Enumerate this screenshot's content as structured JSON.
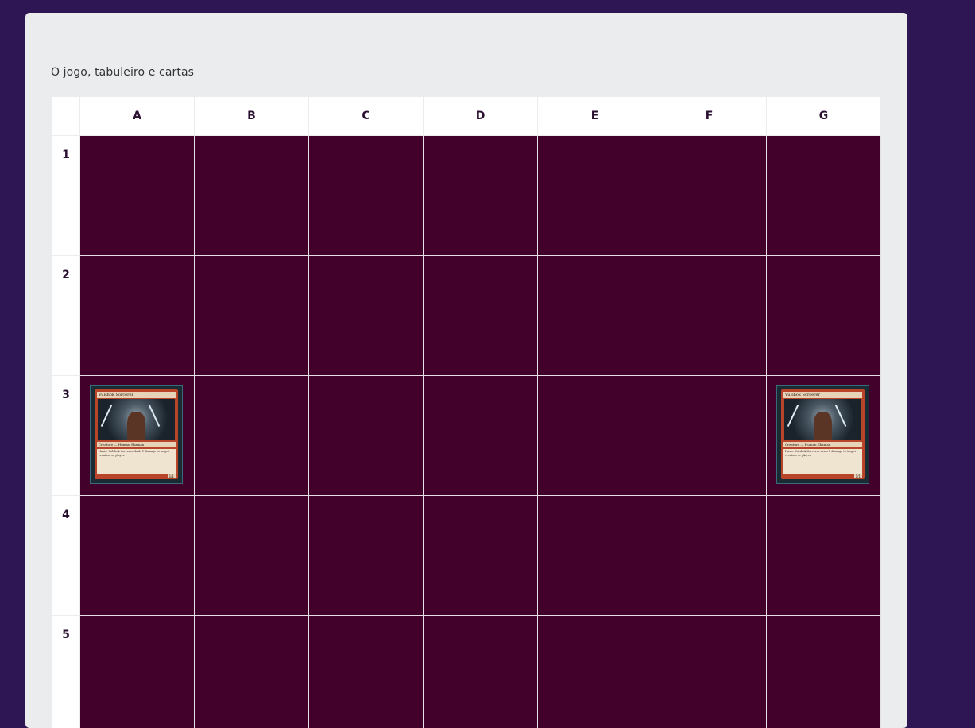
{
  "caption": "O jogo, tabuleiro e cartas",
  "board": {
    "columns": [
      "A",
      "B",
      "C",
      "D",
      "E",
      "F",
      "G"
    ],
    "rows": [
      "1",
      "2",
      "3",
      "4",
      "5"
    ],
    "cards": [
      {
        "row": "3",
        "col": "A",
        "name": "Vulshok Sorcerer",
        "type": "Creature — Human Shaman",
        "text": "Haste. Vulshok Sorcerer deals 1 damage to target creature or player.",
        "pt": "1/1"
      },
      {
        "row": "3",
        "col": "G",
        "name": "Vulshok Sorcerer",
        "type": "Creature — Human Shaman",
        "text": "Haste. Vulshok Sorcerer deals 1 damage to target creature or player.",
        "pt": "1/1"
      }
    ]
  },
  "colors": {
    "background": "#2e1654",
    "panel": "#ebecee",
    "cell": "#42012b",
    "header": "#ffffff"
  }
}
